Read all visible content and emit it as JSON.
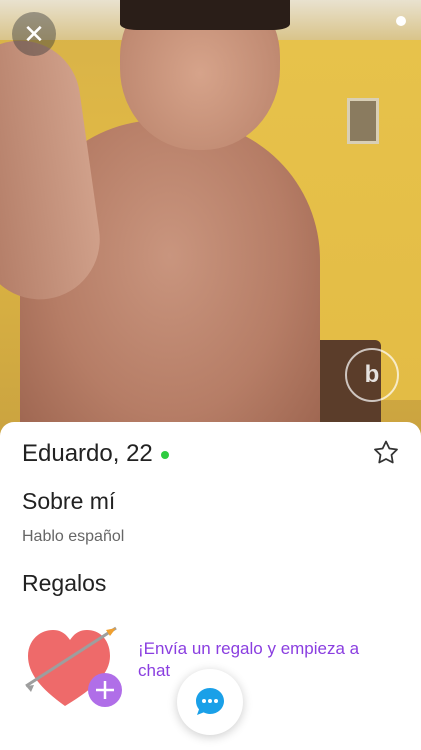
{
  "photo": {
    "close_icon": "close-icon",
    "watermark_text": "b"
  },
  "profile": {
    "name_age": "Eduardo, 22",
    "online_color": "#2ecc40"
  },
  "about": {
    "title": "Sobre mí",
    "languages": "Hablo español"
  },
  "gifts": {
    "title": "Regalos",
    "cta": "¡Envía un regalo y empieza a chat"
  },
  "colors": {
    "accent": "#8a3ee0",
    "chat": "#1aa0e8"
  }
}
